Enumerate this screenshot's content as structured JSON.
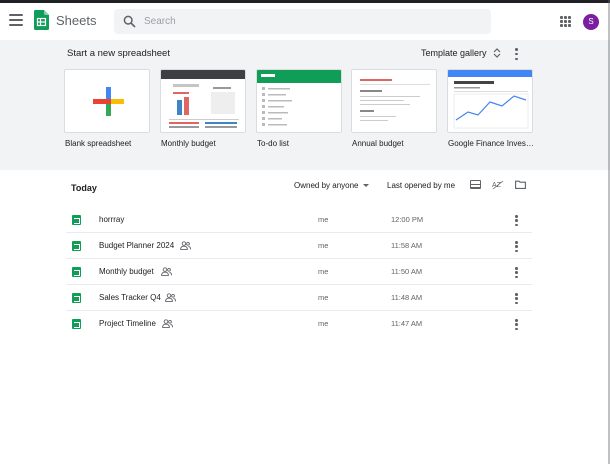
{
  "header": {
    "app_name": "Sheets",
    "search_placeholder": "Search",
    "avatar_initial": "S",
    "accent": "#7b1fa2"
  },
  "templates": {
    "title": "Start a new spreadsheet",
    "gallery_label": "Template gallery",
    "items": [
      {
        "label": "Blank spreadsheet",
        "icon": "plus-icon"
      },
      {
        "label": "Monthly budget",
        "icon": "monthly-budget-thumbnail"
      },
      {
        "label": "To-do list",
        "icon": "todo-list-thumbnail"
      },
      {
        "label": "Annual budget",
        "icon": "annual-budget-thumbnail"
      },
      {
        "label": "Google Finance Inves…",
        "icon": "finance-thumbnail"
      }
    ]
  },
  "files": {
    "section_title": "Today",
    "owned_filter": "Owned by anyone",
    "sort_label": "Last opened by me",
    "rows": [
      {
        "name": "horrray",
        "shared": false,
        "owner": "me",
        "time": "12:00 PM"
      },
      {
        "name": "Budget Planner 2024",
        "shared": true,
        "owner": "me",
        "time": "11:58 AM"
      },
      {
        "name": "Monthly budget",
        "shared": true,
        "owner": "me",
        "time": "11:50 AM"
      },
      {
        "name": "Sales Tracker Q4",
        "shared": true,
        "owner": "me",
        "time": "11:48 AM"
      },
      {
        "name": "Project Timeline",
        "shared": true,
        "owner": "me",
        "time": "11:47 AM"
      }
    ]
  },
  "colors": {
    "sheets_green": "#0f9d58",
    "template_bg": "#f1f3f4"
  }
}
